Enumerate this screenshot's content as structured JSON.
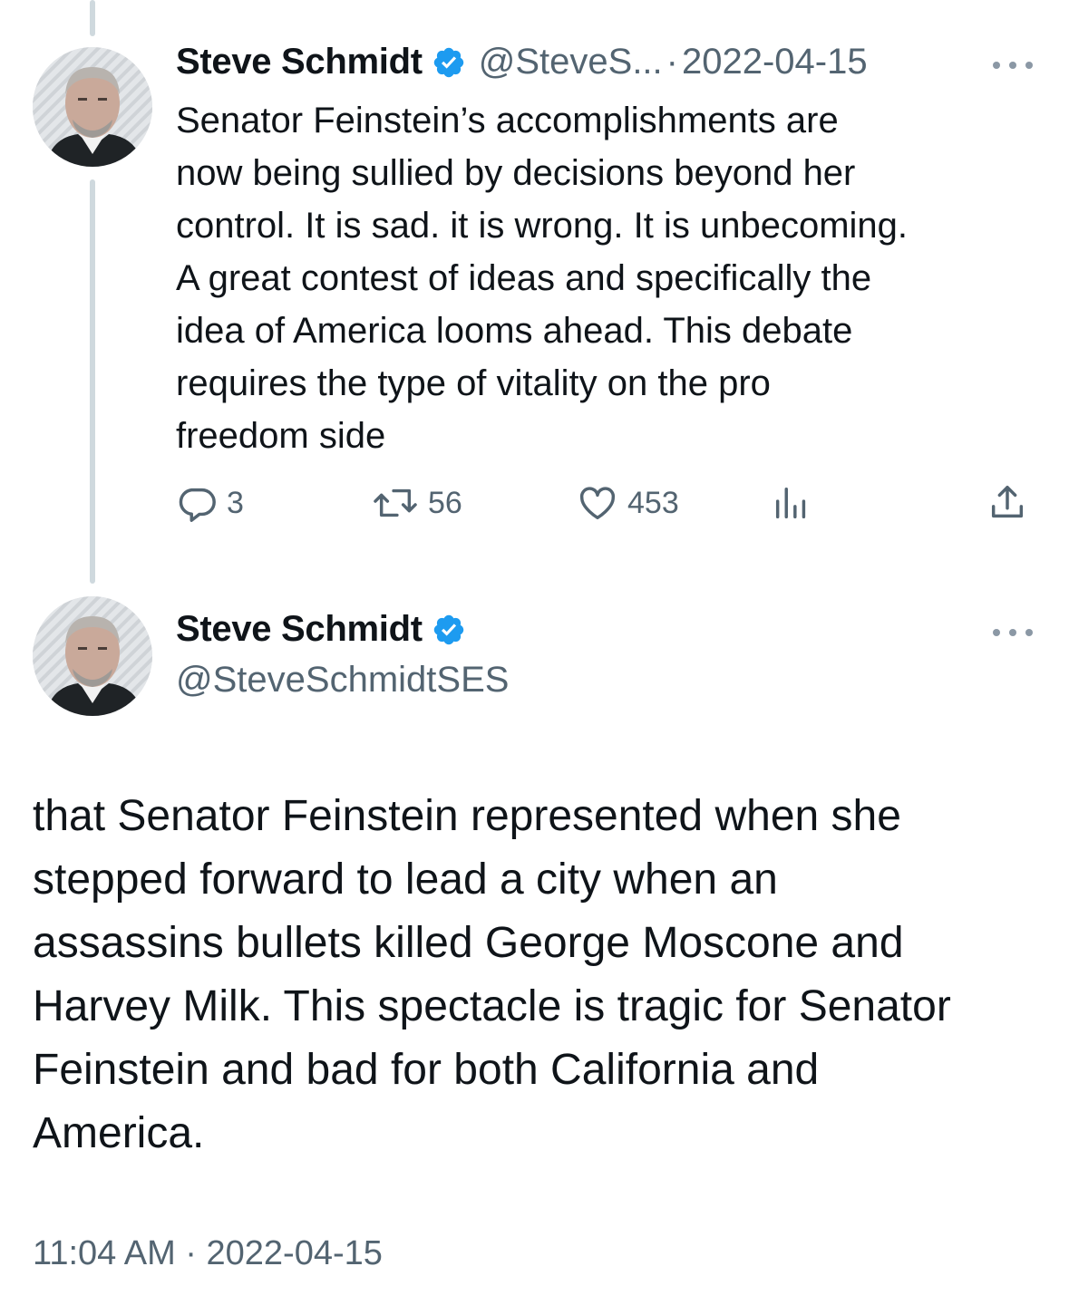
{
  "colors": {
    "text": "#0f1419",
    "secondary": "#536471",
    "verified": "#1d9bf0",
    "thread_line": "#cfd9de"
  },
  "reply_tweet": {
    "display_name": "Steve Schmidt",
    "handle": "@SteveS...",
    "separator": "·",
    "date": "2022-04-15",
    "text_lines": [
      "Senator Feinstein’s accomplishments are",
      "now being sullied by decisions beyond her",
      "control. It is sad. it is wrong. It is unbecoming.",
      "A great contest of ideas and specifically the",
      "idea of America looms ahead. This debate",
      "requires the type of vitality on the pro",
      "freedom side"
    ],
    "actions": {
      "replies": "3",
      "retweets": "56",
      "likes": "453"
    }
  },
  "main_tweet": {
    "display_name": "Steve Schmidt",
    "handle": "@SteveSchmidtSES",
    "text_lines": [
      "that Senator Feinstein represented when she",
      "stepped forward to lead a city when an",
      "assassins bullets killed George Moscone and",
      "Harvey Milk. This spectacle is tragic for Senator",
      "Feinstein and bad for both California and",
      "America."
    ],
    "timestamp": "11:04 AM · 2022-04-15"
  },
  "icons": {
    "verified": "verified-badge-icon",
    "more": "more-options-icon",
    "reply": "reply-icon",
    "retweet": "retweet-icon",
    "like": "like-icon",
    "views": "views-icon",
    "share": "share-icon"
  }
}
